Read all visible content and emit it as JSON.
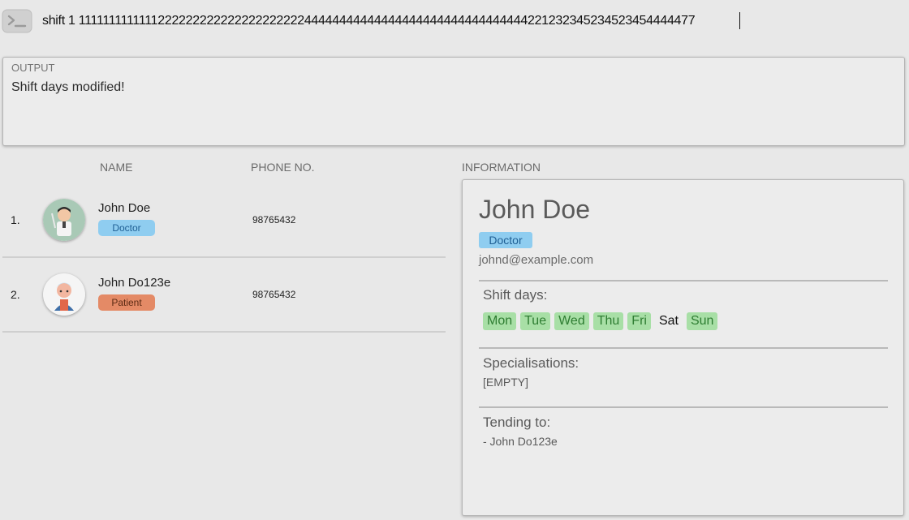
{
  "command": {
    "icon": "terminal-icon",
    "value": "shift 1 111111111111122222222222222222222244444444444444444444444444444444221232345234523454444477"
  },
  "output": {
    "label": "OUTPUT",
    "message": "Shift days modified!"
  },
  "list": {
    "headers": {
      "name": "NAME",
      "phone": "PHONE NO."
    },
    "rows": [
      {
        "index": "1.",
        "name": "John Doe",
        "role": "Doctor",
        "phone": "98765432",
        "avatar": "doctor-avatar-icon"
      },
      {
        "index": "2.",
        "name": "John Do123e",
        "role": "Patient",
        "phone": "98765432",
        "avatar": "patient-avatar-icon"
      }
    ]
  },
  "info": {
    "header": "INFORMATION",
    "name": "John Doe",
    "role": "Doctor",
    "email": "johnd@example.com",
    "shift_title": "Shift days:",
    "days": [
      {
        "label": "Mon",
        "active": true
      },
      {
        "label": "Tue",
        "active": true
      },
      {
        "label": "Wed",
        "active": true
      },
      {
        "label": "Thu",
        "active": true
      },
      {
        "label": "Fri",
        "active": true
      },
      {
        "label": "Sat",
        "active": false
      },
      {
        "label": "Sun",
        "active": true
      }
    ],
    "specialisations_title": "Specialisations:",
    "specialisations_value": "[EMPTY]",
    "tending_title": "Tending to:",
    "tending_value": "- John Do123e"
  },
  "colors": {
    "background": "#e8e8e8",
    "doctor_tag": "#8fcdf0",
    "patient_tag": "#e48a66",
    "shift_active": "#a8dfa6"
  }
}
